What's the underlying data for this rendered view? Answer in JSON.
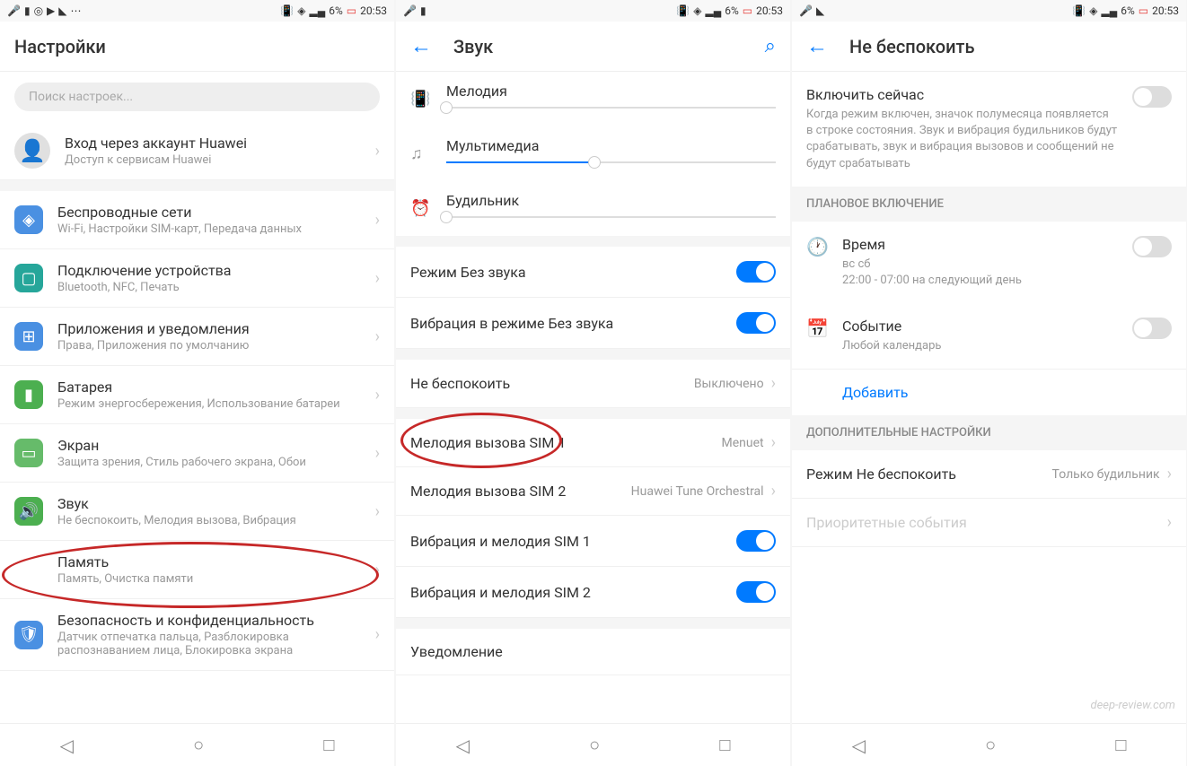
{
  "status": {
    "battery": "6%",
    "time": "20:53"
  },
  "screen1": {
    "title": "Настройки",
    "searchPlaceholder": "Поиск настроек...",
    "account": {
      "title": "Вход через аккаунт Huawei",
      "sub": "Доступ к сервисам Huawei"
    },
    "items": [
      {
        "title": "Беспроводные сети",
        "sub": "Wi-Fi, Настройки SIM-карт, Передача данных"
      },
      {
        "title": "Подключение устройства",
        "sub": "Bluetooth, NFC, Печать"
      },
      {
        "title": "Приложения и уведомления",
        "sub": "Права, Приложения по умолчанию"
      },
      {
        "title": "Батарея",
        "sub": "Режим энергосбережения, Использование батареи"
      },
      {
        "title": "Экран",
        "sub": "Защита зрения, Стиль рабочего экрана, Обои"
      },
      {
        "title": "Звук",
        "sub": "Не беспокоить, Мелодия вызова, Вибрация"
      },
      {
        "title": "Память",
        "sub": "Память, Очистка памяти"
      },
      {
        "title": "Безопасность и конфиденциальность",
        "sub": "Датчик отпечатка пальца, Разблокировка распознаванием лица, Блокировка экрана"
      }
    ]
  },
  "screen2": {
    "title": "Звук",
    "sliders": [
      {
        "label": "Мелодия",
        "value": 0
      },
      {
        "label": "Мультимедиа",
        "value": 45
      },
      {
        "label": "Будильник",
        "value": 0
      }
    ],
    "toggles": [
      {
        "label": "Режим Без звука",
        "on": true
      },
      {
        "label": "Вибрация в режиме Без звука",
        "on": true
      }
    ],
    "dnd": {
      "label": "Не беспокоить",
      "value": "Выключено"
    },
    "ringtones": [
      {
        "label": "Мелодия вызова SIM 1",
        "value": "Menuet"
      },
      {
        "label": "Мелодия вызова SIM 2",
        "value": "Huawei Tune Orchestral"
      }
    ],
    "vibeToggles": [
      {
        "label": "Вибрация и мелодия SIM 1",
        "on": true
      },
      {
        "label": "Вибрация и мелодия SIM 2",
        "on": true
      }
    ],
    "notification": "Уведомление"
  },
  "screen3": {
    "title": "Не беспокоить",
    "enable": {
      "title": "Включить сейчас",
      "desc": "Когда режим включен, значок полумесяца появляется в строке состояния. Звук и вибрация будильников будут срабатывать, звук и вибрация вызовов и сообщений не будут срабатывать"
    },
    "scheduleHeader": "ПЛАНОВОЕ ВКЛЮЧЕНИЕ",
    "time": {
      "title": "Время",
      "sub1": "вс сб",
      "sub2": "22:00 - 07:00 на следующий день"
    },
    "event": {
      "title": "Событие",
      "sub": "Любой календарь"
    },
    "addLink": "Добавить",
    "advancedHeader": "ДОПОЛНИТЕЛЬНЫЕ НАСТРОЙКИ",
    "mode": {
      "label": "Режим Не беспокоить",
      "value": "Только будильник"
    },
    "priority": "Приоритетные события"
  },
  "watermark": "deep-review.com"
}
